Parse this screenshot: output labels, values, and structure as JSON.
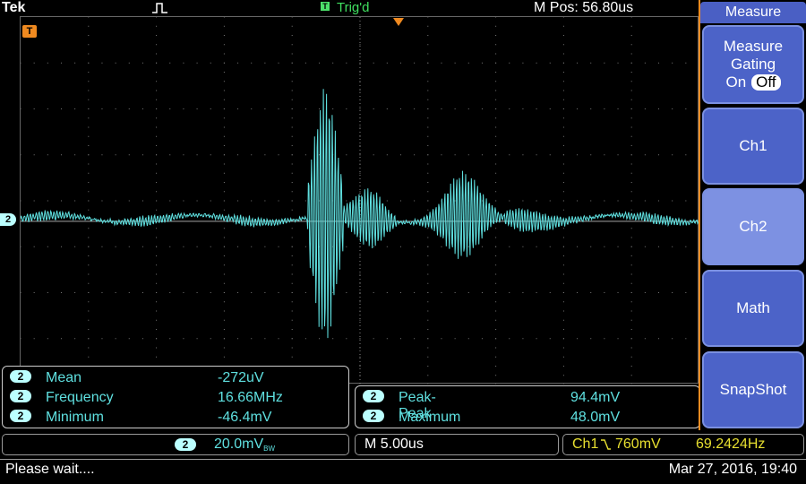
{
  "header": {
    "brand": "Tek",
    "trigger_status": "Trig'd",
    "m_pos": "M Pos: 56.80us"
  },
  "markers": {
    "trigger_level_label": "T",
    "ch2_ground_label": "2"
  },
  "measurements_left": [
    {
      "channel": "2",
      "name": "Mean",
      "value": "-272uV"
    },
    {
      "channel": "2",
      "name": "Frequency",
      "value": "16.66MHz"
    },
    {
      "channel": "2",
      "name": "Minimum",
      "value": "-46.4mV"
    }
  ],
  "measurements_right": [
    {
      "channel": "2",
      "name": "Peak-Peak",
      "value": "94.4mV"
    },
    {
      "channel": "2",
      "name": "Maximum",
      "value": "48.0mV"
    }
  ],
  "status": {
    "ch2_badge": "2",
    "ch2_scale": "20.0mV",
    "ch2_bw": "BW",
    "timebase": "M 5.00us",
    "trigger_channel": "Ch1",
    "trigger_level": "760mV",
    "trigger_frequency": "69.2424Hz"
  },
  "message": {
    "text": "Please wait....",
    "datetime": "Mar 27, 2016, 19:40"
  },
  "side_menu": {
    "title": "Measure",
    "gating_line1": "Measure",
    "gating_line2": "Gating",
    "gating_on": "On",
    "gating_off": "Off",
    "ch1": "Ch1",
    "ch2": "Ch2",
    "math": "Math",
    "snapshot": "SnapShot"
  },
  "colors": {
    "trace": "#5fe0e0",
    "menu_bg": "#4c63c8",
    "trigger": "#e8e030",
    "trig_status": "#40e060"
  }
}
